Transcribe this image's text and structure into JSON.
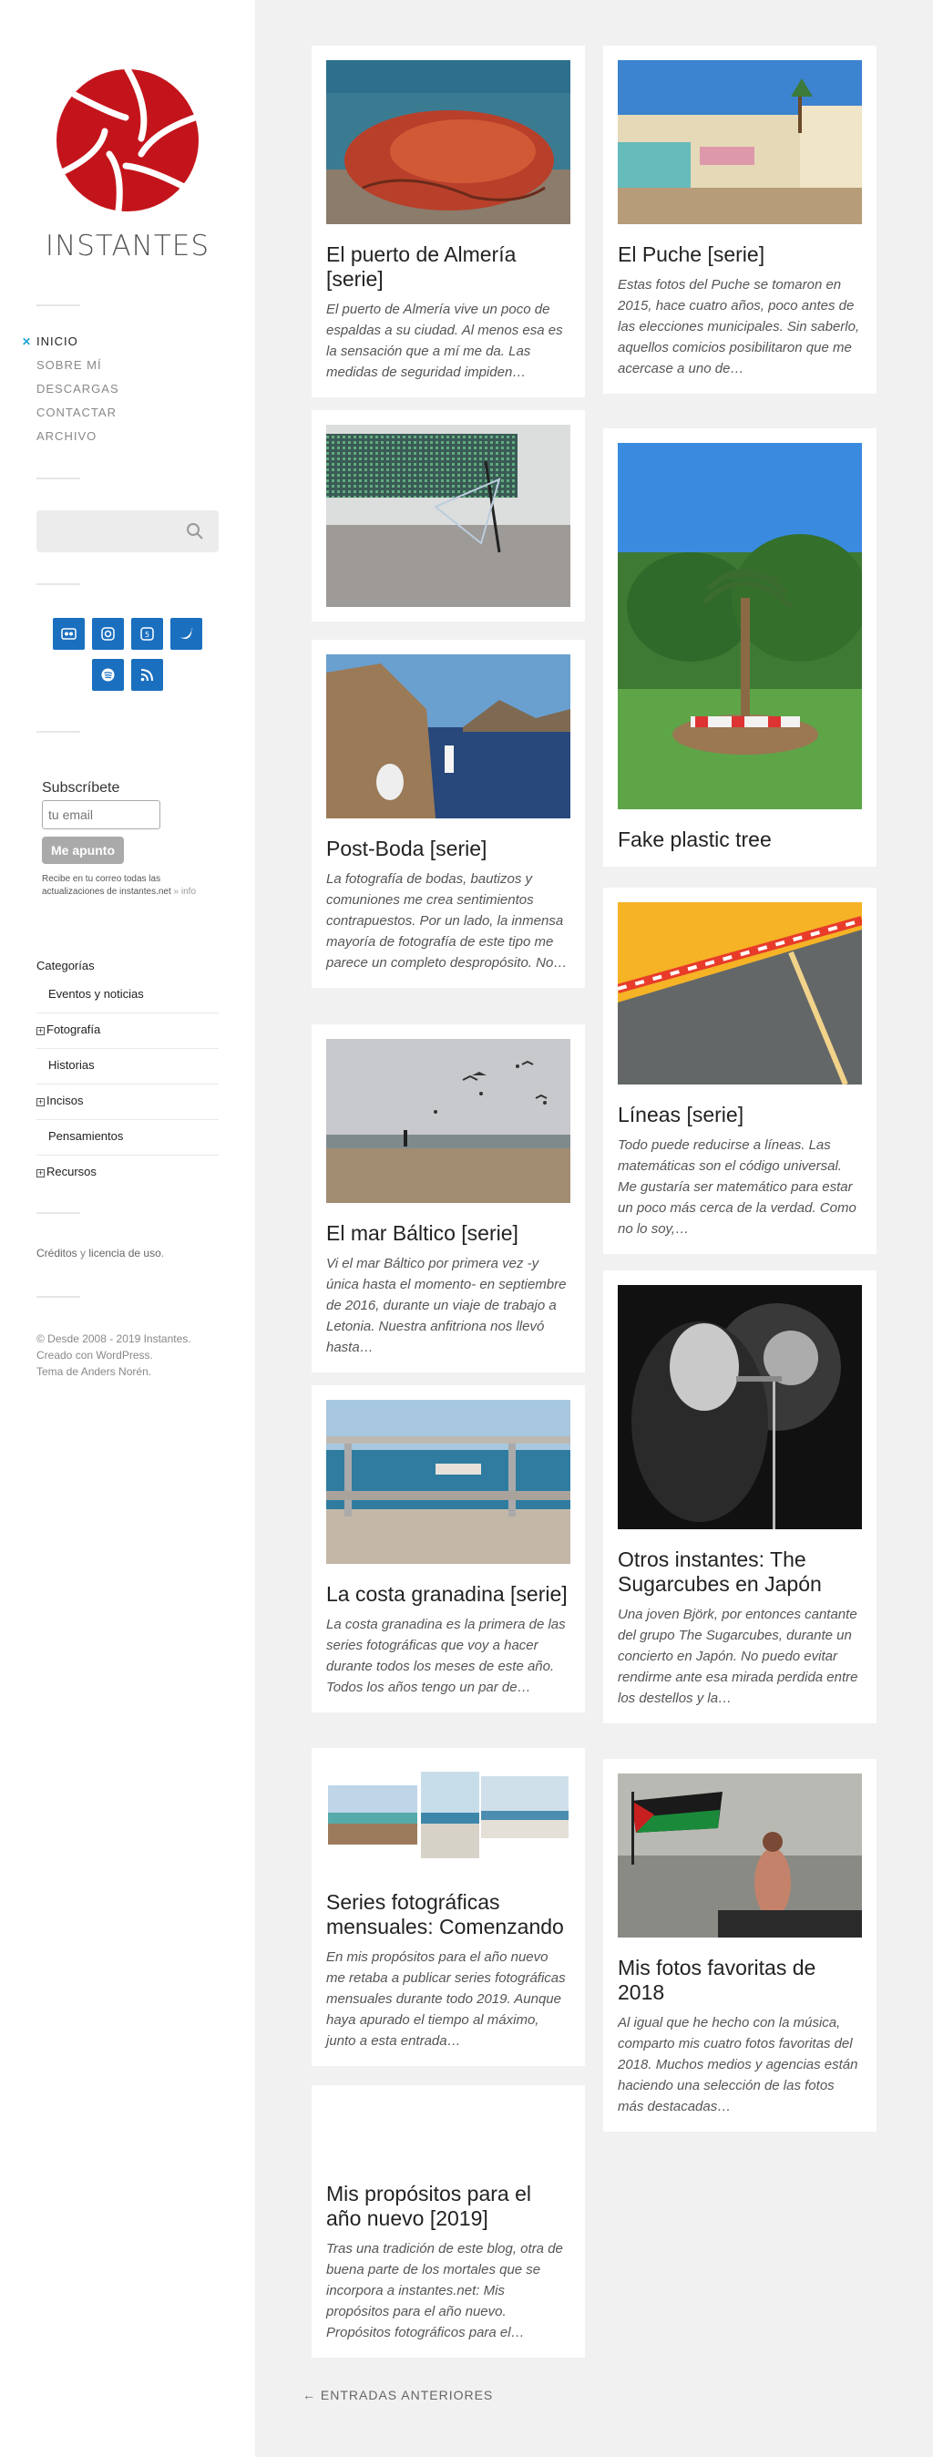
{
  "site": {
    "title": "INSTANTES"
  },
  "nav": [
    {
      "label": "INICIO",
      "active": true
    },
    {
      "label": "SOBRE MÍ"
    },
    {
      "label": "DESCARGAS"
    },
    {
      "label": "CONTACTAR"
    },
    {
      "label": "ARCHIVO"
    }
  ],
  "social": [
    "flickr-icon",
    "instagram-icon",
    "500px-icon",
    "twitter-icon",
    "spotify-icon",
    "rss-icon"
  ],
  "subscribe": {
    "heading": "Subscríbete",
    "placeholder": "tu email",
    "button": "Me apunto",
    "note": "Recibe en tu correo todas las actualizaciones de instantes.net",
    "info": "» info"
  },
  "categories": {
    "heading": "Categorías",
    "items": [
      {
        "label": "Eventos y noticias",
        "expandable": false
      },
      {
        "label": "Fotografía",
        "expandable": true
      },
      {
        "label": "Historias",
        "expandable": false
      },
      {
        "label": "Incisos",
        "expandable": true
      },
      {
        "label": "Pensamientos",
        "expandable": false
      },
      {
        "label": "Recursos",
        "expandable": true
      }
    ]
  },
  "credits": {
    "a": "Créditos",
    "and": " y ",
    "b": "licencia de uso",
    "end": "."
  },
  "copyright": [
    "© Desde 2008 - 2019 Instantes.",
    "Creado con WordPress.",
    "Tema de Anders Norén."
  ],
  "colors": {
    "accent": "#1da1d6",
    "social": "#1a6fbf",
    "logo": "#c4141b"
  },
  "posts": [
    {
      "title": "El puerto de Almería [serie]",
      "excerpt": "El puerto de Almería vive un poco de espaldas a su ciudad. Al menos esa es la sensación que a mí me da. Las medidas de seguridad impiden…"
    },
    {
      "title": "El Puche [serie]",
      "excerpt": "Estas fotos del Puche se tomaron en 2015, hace cuatro años, poco antes de las elecciones municipales. Sin saberlo, aquellos comicios posibilitaron que me acercase a uno de…"
    },
    {
      "title": "",
      "excerpt": ""
    },
    {
      "title": "Fake plastic tree",
      "excerpt": ""
    },
    {
      "title": "Post-Boda [serie]",
      "excerpt": "La fotografía de bodas, bautizos y comuniones me crea sentimientos contrapuestos. Por un lado,  la inmensa mayoría de fotografía de este tipo me parece un completo despropósito. No…"
    },
    {
      "title": "Líneas [serie]",
      "excerpt": "Todo puede reducirse a líneas. Las matemáticas son el código universal. Me gustaría ser matemático para estar un poco más cerca de la verdad. Como no lo soy,…"
    },
    {
      "title": "El mar Báltico [serie]",
      "excerpt": "Vi el mar Báltico por primera vez -y única hasta el momento- en septiembre de 2016, durante un viaje de trabajo a Letonia. Nuestra anfitriona nos llevó hasta…"
    },
    {
      "title": "Otros instantes: The Sugarcubes en Japón",
      "excerpt": "Una joven Björk, por entonces cantante del grupo  The Sugarcubes, durante un concierto en Japón. No puedo evitar rendirme ante esa mirada perdida entre los destellos y la…"
    },
    {
      "title": "La costa granadina [serie]",
      "excerpt": "La costa granadina es la primera de las series fotográficas que voy a hacer durante todos los meses de este año. Todos los años tengo un par de…"
    },
    {
      "title": "Mis fotos favoritas de 2018",
      "excerpt": "Al igual que he hecho con la música, comparto mis cuatro fotos favoritas del 2018. Muchos medios y agencias están haciendo una selección de las fotos más destacadas…"
    },
    {
      "title": "Series fotográficas mensuales: Comenzando",
      "excerpt": "En mis propósitos para el año nuevo me retaba a publicar series fotográficas mensuales durante todo 2019. Aunque haya apurado el tiempo al máximo, junto a esta entrada…"
    },
    {
      "title": "Mis propósitos para el año nuevo [2019]",
      "excerpt": "Tras una tradición de este blog, otra de buena parte de los mortales que se incorpora a instantes.net: Mis propósitos para el año nuevo. Propósitos fotográficos para el…"
    }
  ],
  "older": "← ENTRADAS ANTERIORES"
}
